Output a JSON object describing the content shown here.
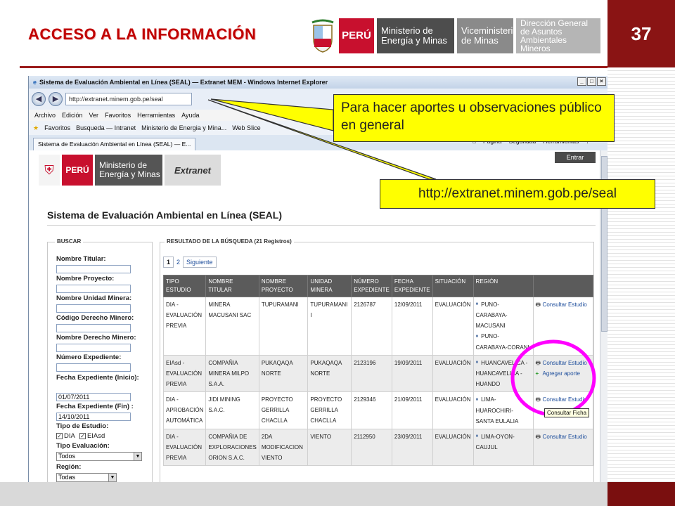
{
  "slide": {
    "title": "ACCESO A LA INFORMACIÓN",
    "page_number": "37",
    "logo": {
      "peru": "PERÚ",
      "ministry": "Ministerio de Energía y Minas",
      "vice": "Viceministerio de Minas",
      "direction": "Dirección General de Asuntos Ambientales Mineros"
    },
    "accent_color": "#c00000"
  },
  "browser": {
    "window_title": "Sistema de Evaluación Ambiental en Línea (SEAL) — Extranet MEM - Windows Internet Explorer",
    "url": "http://extranet.minem.gob.pe/seal",
    "menu": [
      "Archivo",
      "Edición",
      "Ver",
      "Favoritos",
      "Herramientas",
      "Ayuda"
    ],
    "favorites": {
      "label": "Favoritos",
      "items": [
        "Busqueda — Intranet",
        "Ministerio de Energia y Mina...",
        "Web Slice"
      ]
    },
    "tab_title": "Sistema de Evaluación Ambiental en Línea (SEAL) — E...",
    "commands": [
      "Página",
      "Seguridad",
      "Herramientas"
    ]
  },
  "site": {
    "logo_peru": "PERÚ",
    "logo_ministry": "Ministerio de Energía y Minas",
    "logo_extranet": "Extranet",
    "enter_button": "Entrar",
    "title": "Sistema de Evaluación Ambiental en Línea (SEAL)"
  },
  "search": {
    "legend": "BUSCAR",
    "titular_label": "Nombre Titular:",
    "proyecto_label": "Nombre Proyecto:",
    "unidad_label": "Nombre Unidad Minera:",
    "codigo_label": "Código Derecho Minero:",
    "derecho_label": "Nombre Derecho Minero:",
    "expediente_label": "Número Expediente:",
    "fecha_inicio_label": "Fecha Expediente (Inicio):",
    "fecha_inicio_value": "01/07/2011",
    "fecha_fin_label": "Fecha Expediente (Fin) :",
    "fecha_fin_value": "14/10/2011",
    "tipo_estudio_label": "Tipo de Estudio:",
    "tipo_dia": "DIA",
    "tipo_eiasd": "EIAsd",
    "tipo_eval_label": "Tipo Evaluación:",
    "tipo_eval_value": "Todos",
    "region_label": "Región:",
    "region_value": "Todas"
  },
  "results": {
    "legend": "RESULTADO DE LA BÚSQUEDA (21 Registros)",
    "pages": [
      "1",
      "2"
    ],
    "next_label": "Siguiente",
    "headers": [
      "TIPO ESTUDIO",
      "NOMBRE TITULAR",
      "NOMBRE PROYECTO",
      "UNIDAD MINERA",
      "NÚMERO EXPEDIENTE",
      "FECHA EXPEDIENTE",
      "SITUACIÓN",
      "REGIÓN",
      ""
    ],
    "rows": [
      {
        "tipo": "DIA - EVALUACIÓN PREVIA",
        "titular": "MINERA MACUSANI SAC",
        "proyecto": "TUPURAMANI",
        "unidad": "TUPURAMANI I",
        "numero": "2126787",
        "fecha": "12/09/2011",
        "situacion": "EVALUACIÓN",
        "regiones": [
          "PUNO-CARABAYA-MACUSANI",
          "PUNO-CARABAYA-CORANI"
        ],
        "consultar": "Consultar Estudio"
      },
      {
        "tipo": "EIAsd - EVALUACIÓN PREVIA",
        "titular": "COMPAÑIA MINERA MILPO S.A.A.",
        "proyecto": "PUKAQAQA NORTE",
        "unidad": "PUKAQAQA NORTE",
        "numero": "2123196",
        "fecha": "19/09/2011",
        "situacion": "EVALUACIÓN",
        "regiones": [
          "HUANCAVELICA - HUANCAVELICA -HUANDO"
        ],
        "consultar": "Consultar Estudio",
        "agregar": "Agregar aporte"
      },
      {
        "tipo": "DIA - APROBACIÓN AUTOMÁTICA",
        "titular": "JIDI MINING S.A.C.",
        "proyecto": "PROYECTO GERRILLA CHACLLA",
        "unidad": "PROYECTO GERRILLA CHACLLA",
        "numero": "2129346",
        "fecha": "21/09/2011",
        "situacion": "EVALUACIÓN",
        "regiones": [
          "LIMA-HUAROCHIRI-SANTA EULALIA"
        ],
        "consultar": "Consultar Estudio"
      },
      {
        "tipo": "DIA - EVALUACIÓN PREVIA",
        "titular": "COMPAÑIA DE EXPLORACIONES ORION S.A.C.",
        "proyecto": "2DA MODIFICACION VIENTO",
        "unidad": "VIENTO",
        "numero": "2112950",
        "fecha": "23/09/2011",
        "situacion": "EVALUACIÓN",
        "regiones": [
          "LIMA-OYON-CAUJUL"
        ],
        "consultar": "Consultar Estudio"
      }
    ],
    "tooltip": "Consultar Ficha"
  },
  "callouts": {
    "note": "Para hacer aportes u observaciones público en general",
    "url": "http://extranet.minem.gob.pe/seal",
    "highlight_color": "#ffff00",
    "ring_color": "#ff00ff"
  }
}
